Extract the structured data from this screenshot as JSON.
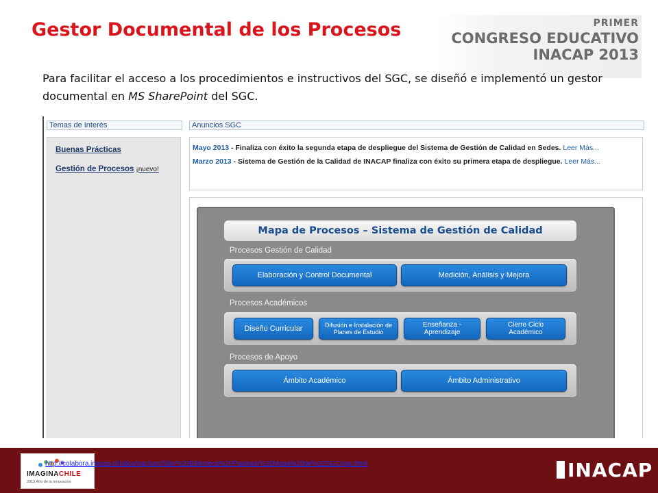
{
  "slide": {
    "title": "Gestor Documental de los Procesos",
    "intro_part1": "Para facilitar el acceso a los procedimientos e instructivos del SGC, se diseñó e implementó un gestor documental en ",
    "intro_italic": "MS SharePoint",
    "intro_part2": " del SGC."
  },
  "congreso": {
    "line1": "PRIMER",
    "line2": "CONGRESO EDUCATIVO",
    "line3": "INACAP 2013"
  },
  "sharepoint": {
    "left_header": "Temas de Interés",
    "links": [
      {
        "label": "Buenas Prácticas",
        "badge": ""
      },
      {
        "label": "Gestión de Procesos",
        "badge": "¡nuevo!"
      }
    ],
    "right_header": "Anuncios SGC",
    "announcements": [
      {
        "date": "Mayo 2013",
        "text": " - Finaliza con éxito la segunda etapa de despliegue del Sistema de Gestión de Calidad en Sedes.",
        "more": "Leer Más..."
      },
      {
        "date": "Marzo 2013",
        "text": " - Sistema de Gestión de la Calidad de INACAP finaliza con éxito su primera etapa de despliegue.",
        "more": "Leer Más..."
      }
    ]
  },
  "map": {
    "title": "Mapa de Procesos – Sistema de Gestión de Calidad",
    "groups": [
      {
        "label": "Procesos Gestión de Calidad",
        "buttons": [
          "Elaboración y Control Documental",
          "Medición, Análisis y Mejora"
        ]
      },
      {
        "label": "Procesos Académicos",
        "buttons": [
          "Diseño Curricular",
          "Difusión e Instalación de Planes de Estudio",
          "Enseñanza - Aprendizaje",
          "Cierre Ciclo Académico"
        ]
      },
      {
        "label": "Procesos de Apoyo",
        "buttons": [
          "Ámbito Académico",
          "Ámbito Administrativo"
        ]
      }
    ]
  },
  "footer": {
    "url": "http://colabora.inacap.cl/sitios/sgc/sgc/Sitio%20Biblioteca%20Paginas/%20Mapa%20de%20SGC/sgc.html",
    "imagina_brand": "IMAGINA",
    "imagina_brand_red": "CHILE",
    "imagina_sub": "2013 Año de la Innovación",
    "inacap_logo": "INACAP"
  },
  "colors": {
    "title_red": "#d9141b",
    "footer_maroon": "#6e0f13",
    "button_blue": "#1f7ad4",
    "link_blue": "#1f5fa8"
  }
}
